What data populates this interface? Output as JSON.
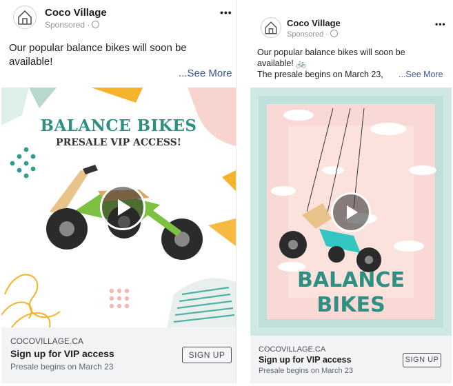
{
  "ads": [
    {
      "page_name": "Coco Village",
      "sponsored": "Sponsored ·",
      "more_label": "•••",
      "text_lines": [
        "Our popular balance bikes will soon be",
        "available!"
      ],
      "see_more": "...See More",
      "media": {
        "title_line1": "BALANCE BIKES",
        "title_line2": "PRESALE VIP ACCESS!"
      },
      "footer": {
        "domain": "COCOVILLAGE.CA",
        "headline": "Sign up for VIP access",
        "description": "Presale begins on March 23",
        "cta": "SIGN UP"
      }
    },
    {
      "page_name": "Coco Village",
      "sponsored": "Sponsored ·",
      "more_label": "•••",
      "text_lines": [
        "Our popular balance bikes will soon be",
        "available! 🚲",
        "The presale begins on March 23,"
      ],
      "see_more": "...See More",
      "media": {
        "title_line1": "BALANCE",
        "title_line2": "BIKES"
      },
      "footer": {
        "domain": "COCOVILLAGE.CA",
        "headline": "Sign up for VIP access",
        "description": "Presale begins on March 23",
        "cta": "SIGN UP"
      }
    }
  ],
  "colors": {
    "link": "#385898",
    "title_teal": "#2f8f82",
    "bike_green": "#7cc242",
    "bike_teal": "#34c6c2",
    "footer_bg": "#f2f3f5"
  }
}
